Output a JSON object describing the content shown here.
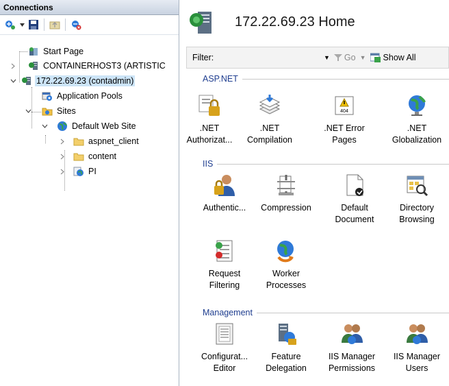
{
  "connections": {
    "title": "Connections",
    "toolbar_icons": [
      "connect-icon",
      "dropdown-arrow-icon",
      "save-icon",
      "folder-up-icon",
      "disconnect-icon"
    ],
    "tree": [
      {
        "label": "Start Page",
        "icon": "start-page-icon"
      },
      {
        "label": "CONTAINERHOST3 (ARTISTIC",
        "icon": "server-icon"
      },
      {
        "label": "172.22.69.23 (contadmin)",
        "icon": "server-icon",
        "selected": true
      },
      {
        "label": "Application Pools",
        "icon": "app-pools-icon"
      },
      {
        "label": "Sites",
        "icon": "sites-folder-icon"
      },
      {
        "label": "Default Web Site",
        "icon": "globe-icon"
      },
      {
        "label": "aspnet_client",
        "icon": "folder-icon"
      },
      {
        "label": "content",
        "icon": "folder-icon"
      },
      {
        "label": "PI",
        "icon": "web-app-icon"
      }
    ]
  },
  "main": {
    "title": "172.22.69.23 Home",
    "filter": {
      "label": "Filter:",
      "go": "Go",
      "show_all": "Show All"
    },
    "groups": [
      {
        "name": "ASP.NET",
        "features": [
          {
            "label": ".NET Authorizat...",
            "l1": ".NET",
            "l2": "Authorizat...",
            "icon": "net-authorization-icon"
          },
          {
            "label": ".NET Compilation",
            "l1": ".NET",
            "l2": "Compilation",
            "icon": "net-compilation-icon"
          },
          {
            "label": ".NET Error Pages",
            "l1": ".NET Error",
            "l2": "Pages",
            "icon": "net-error-pages-icon"
          },
          {
            "label": ".NET Globalization",
            "l1": ".NET",
            "l2": "Globalization",
            "icon": "net-globalization-icon"
          }
        ]
      },
      {
        "name": "IIS",
        "features": [
          {
            "label": "Authentic...",
            "l1": "Authentic...",
            "l2": "",
            "icon": "authentication-icon"
          },
          {
            "label": "Compression",
            "l1": "Compression",
            "l2": "",
            "icon": "compression-icon"
          },
          {
            "label": "Default Document",
            "l1": "Default",
            "l2": "Document",
            "icon": "default-document-icon"
          },
          {
            "label": "Directory Browsing",
            "l1": "Directory",
            "l2": "Browsing",
            "icon": "directory-browsing-icon"
          },
          {
            "label": "Request Filtering",
            "l1": "Request",
            "l2": "Filtering",
            "icon": "request-filtering-icon"
          },
          {
            "label": "Worker Processes",
            "l1": "Worker",
            "l2": "Processes",
            "icon": "worker-processes-icon"
          }
        ]
      },
      {
        "name": "Management",
        "features": [
          {
            "label": "Configurat... Editor",
            "l1": "Configurat...",
            "l2": "Editor",
            "icon": "configuration-editor-icon"
          },
          {
            "label": "Feature Delegation",
            "l1": "Feature",
            "l2": "Delegation",
            "icon": "feature-delegation-icon"
          },
          {
            "label": "IIS Manager Permissions",
            "l1": "IIS Manager",
            "l2": "Permissions",
            "icon": "iis-manager-permissions-icon"
          },
          {
            "label": "IIS Manager Users",
            "l1": "IIS Manager",
            "l2": "Users",
            "icon": "iis-manager-users-icon"
          }
        ]
      }
    ]
  }
}
